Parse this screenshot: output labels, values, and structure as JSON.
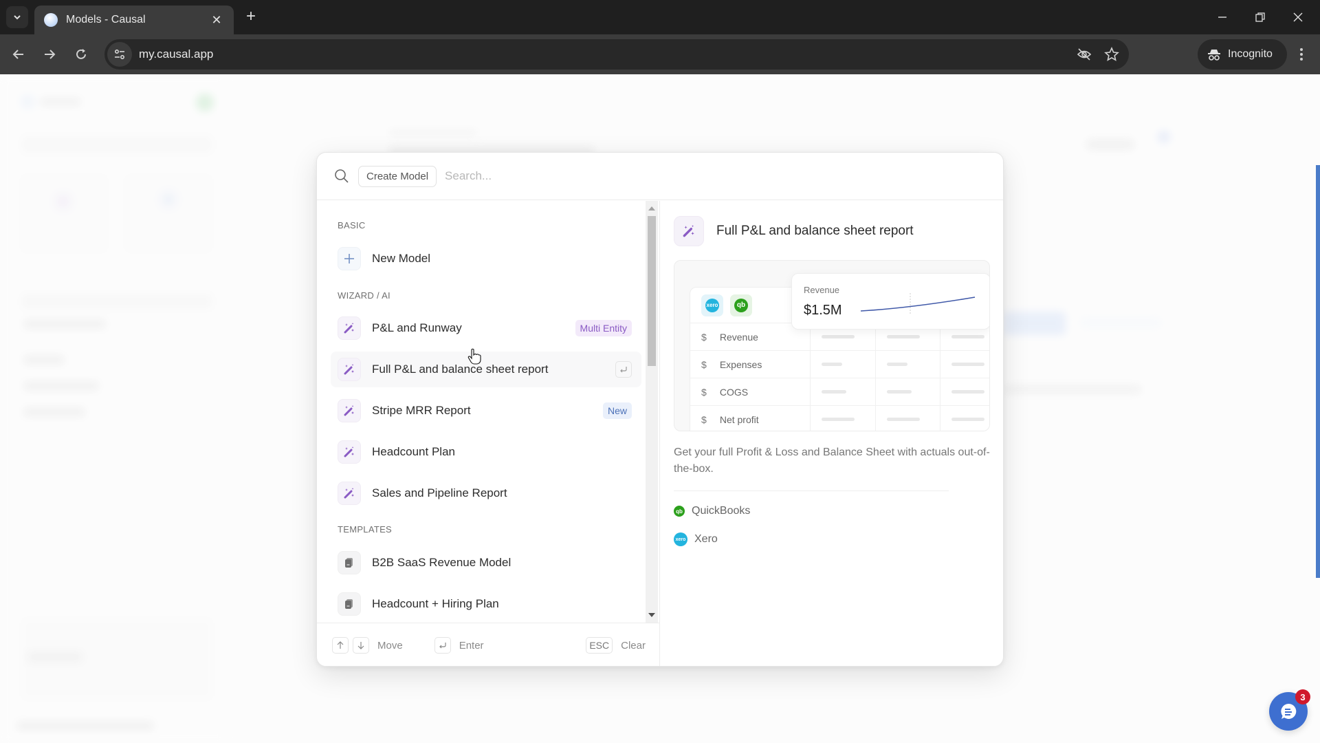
{
  "browser": {
    "tab_title": "Models - Causal",
    "url": "my.causal.app",
    "incognito_label": "Incognito",
    "new_tab_symbol": "+",
    "close_symbol": "✕"
  },
  "dialog": {
    "search": {
      "scope_chip": "Create Model",
      "placeholder": "Search...",
      "value": ""
    },
    "sections": [
      {
        "label": "BASIC",
        "items": [
          {
            "label": "New Model",
            "icon": "plus-icon"
          }
        ]
      },
      {
        "label": "WIZARD / AI",
        "items": [
          {
            "label": "P&L and Runway",
            "icon": "magic-wand-icon",
            "badge": "Multi Entity"
          },
          {
            "label": "Full P&L and balance sheet report",
            "icon": "magic-wand-icon",
            "active": true
          },
          {
            "label": "Stripe MRR Report",
            "icon": "magic-wand-icon",
            "badge": "New"
          },
          {
            "label": "Headcount Plan",
            "icon": "magic-wand-icon"
          },
          {
            "label": "Sales and Pipeline Report",
            "icon": "magic-wand-icon"
          }
        ]
      },
      {
        "label": "TEMPLATES",
        "items": [
          {
            "label": "B2B SaaS Revenue Model",
            "icon": "document-icon"
          },
          {
            "label": "Headcount + Hiring Plan",
            "icon": "document-icon"
          }
        ]
      }
    ],
    "footer": {
      "move_label": "Move",
      "enter_label": "Enter",
      "esc_key": "ESC",
      "clear_label": "Clear"
    },
    "preview": {
      "title": "Full P&L and balance sheet report",
      "card": {
        "revenue_label": "Revenue",
        "revenue_value": "$1.5M",
        "rows": [
          {
            "symbol": "$",
            "name": "Revenue"
          },
          {
            "symbol": "$",
            "name": "Expenses"
          },
          {
            "symbol": "$",
            "name": "COGS"
          },
          {
            "symbol": "$",
            "name": "Net profit"
          }
        ],
        "logos": [
          "xero",
          "qb"
        ]
      },
      "description": "Get your full Profit & Loss and Balance Sheet with actuals out-of-the-box.",
      "integrations": [
        {
          "name": "QuickBooks",
          "logo_text": "qb",
          "color": "#2ca01c"
        },
        {
          "name": "Xero",
          "logo_text": "xero",
          "color": "#23b4de"
        }
      ]
    }
  },
  "chat_widget": {
    "unread_count": "3"
  },
  "colors": {
    "accent_purple": "#8a5bc4",
    "accent_blue": "#3e6fd0",
    "badge_red": "#d0192c"
  }
}
